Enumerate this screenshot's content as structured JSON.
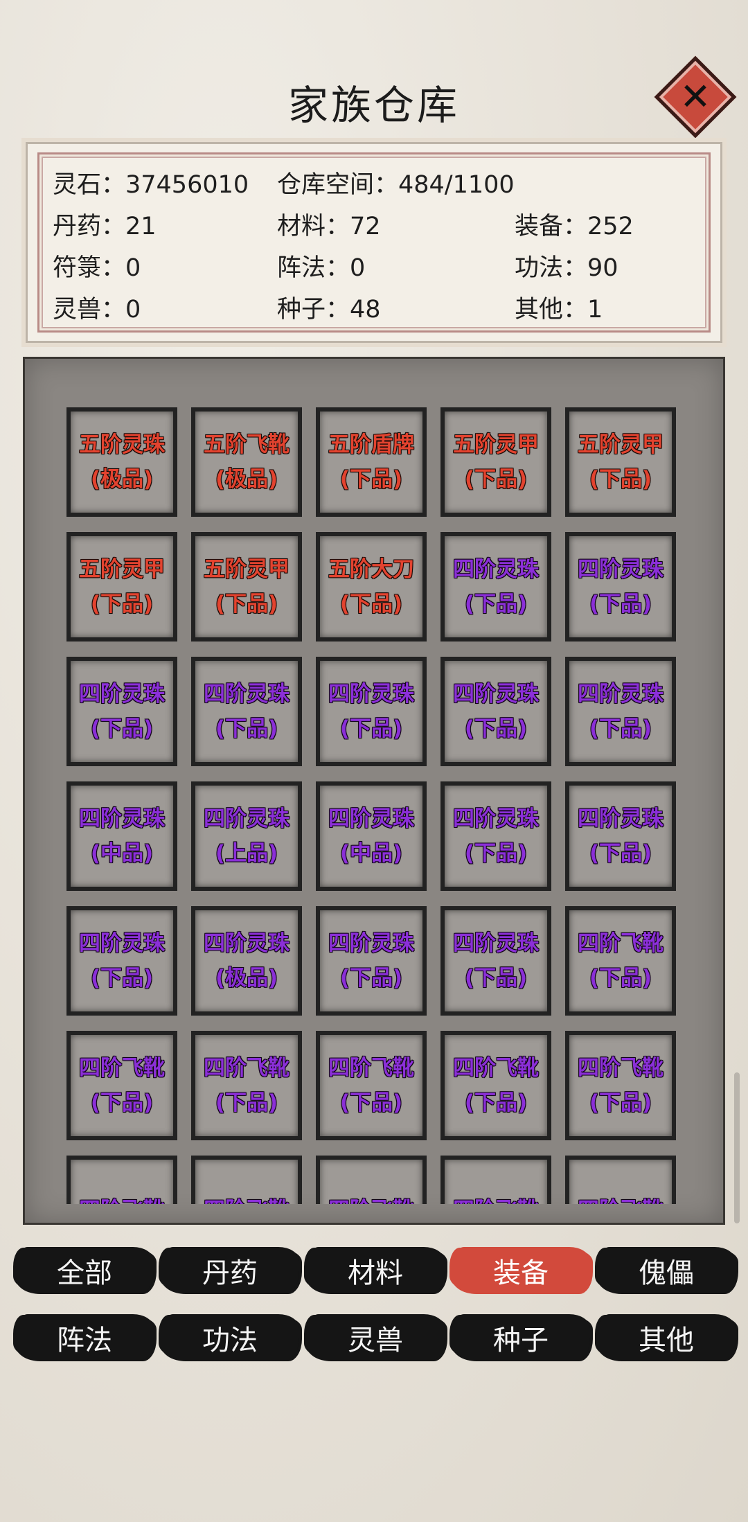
{
  "title": "家族仓库",
  "close_icon": "close-x-icon",
  "info": {
    "lingshi": "灵石：37456010",
    "space": "仓库空间：484/1100",
    "danyao": "丹药：21",
    "cailiao": "材料：72",
    "zhuangbei": "装备：252",
    "fulu": "符箓：0",
    "zhenfa": "阵法：0",
    "gongfa": "功法：90",
    "lingshou": "灵兽：0",
    "zhongzi": "种子：48",
    "qita": "其他：1"
  },
  "items": [
    {
      "name": "五阶灵珠",
      "grade": "(极品)",
      "color": "red"
    },
    {
      "name": "五阶飞靴",
      "grade": "(极品)",
      "color": "red"
    },
    {
      "name": "五阶盾牌",
      "grade": "(下品)",
      "color": "red"
    },
    {
      "name": "五阶灵甲",
      "grade": "(下品)",
      "color": "red"
    },
    {
      "name": "五阶灵甲",
      "grade": "(下品)",
      "color": "red"
    },
    {
      "name": "五阶灵甲",
      "grade": "(下品)",
      "color": "red"
    },
    {
      "name": "五阶灵甲",
      "grade": "(下品)",
      "color": "red"
    },
    {
      "name": "五阶大刀",
      "grade": "(下品)",
      "color": "red"
    },
    {
      "name": "四阶灵珠",
      "grade": "(下品)",
      "color": "purple"
    },
    {
      "name": "四阶灵珠",
      "grade": "(下品)",
      "color": "purple"
    },
    {
      "name": "四阶灵珠",
      "grade": "(下品)",
      "color": "purple"
    },
    {
      "name": "四阶灵珠",
      "grade": "(下品)",
      "color": "purple"
    },
    {
      "name": "四阶灵珠",
      "grade": "(下品)",
      "color": "purple"
    },
    {
      "name": "四阶灵珠",
      "grade": "(下品)",
      "color": "purple"
    },
    {
      "name": "四阶灵珠",
      "grade": "(下品)",
      "color": "purple"
    },
    {
      "name": "四阶灵珠",
      "grade": "(中品)",
      "color": "purple"
    },
    {
      "name": "四阶灵珠",
      "grade": "(上品)",
      "color": "purple"
    },
    {
      "name": "四阶灵珠",
      "grade": "(中品)",
      "color": "purple"
    },
    {
      "name": "四阶灵珠",
      "grade": "(下品)",
      "color": "purple"
    },
    {
      "name": "四阶灵珠",
      "grade": "(下品)",
      "color": "purple"
    },
    {
      "name": "四阶灵珠",
      "grade": "(下品)",
      "color": "purple"
    },
    {
      "name": "四阶灵珠",
      "grade": "(极品)",
      "color": "purple"
    },
    {
      "name": "四阶灵珠",
      "grade": "(下品)",
      "color": "purple"
    },
    {
      "name": "四阶灵珠",
      "grade": "(下品)",
      "color": "purple"
    },
    {
      "name": "四阶飞靴",
      "grade": "(下品)",
      "color": "purple"
    },
    {
      "name": "四阶飞靴",
      "grade": "(下品)",
      "color": "purple"
    },
    {
      "name": "四阶飞靴",
      "grade": "(下品)",
      "color": "purple"
    },
    {
      "name": "四阶飞靴",
      "grade": "(下品)",
      "color": "purple"
    },
    {
      "name": "四阶飞靴",
      "grade": "(下品)",
      "color": "purple"
    },
    {
      "name": "四阶飞靴",
      "grade": "(下品)",
      "color": "purple"
    },
    {
      "name": "四阶飞靴",
      "grade": "",
      "color": "purple"
    },
    {
      "name": "四阶飞靴",
      "grade": "",
      "color": "purple"
    },
    {
      "name": "四阶飞靴",
      "grade": "",
      "color": "purple"
    },
    {
      "name": "四阶飞靴",
      "grade": "",
      "color": "purple"
    },
    {
      "name": "四阶飞靴",
      "grade": "",
      "color": "purple"
    }
  ],
  "tabs": [
    {
      "label": "全部",
      "active": false
    },
    {
      "label": "丹药",
      "active": false
    },
    {
      "label": "材料",
      "active": false
    },
    {
      "label": "装备",
      "active": true
    },
    {
      "label": "傀儡",
      "active": false
    },
    {
      "label": "阵法",
      "active": false
    },
    {
      "label": "功法",
      "active": false
    },
    {
      "label": "灵兽",
      "active": false
    },
    {
      "label": "种子",
      "active": false
    },
    {
      "label": "其他",
      "active": false
    }
  ],
  "colors": {
    "accent_red": "#d24a3c",
    "item_red": "#e3432f",
    "item_purple": "#8b2fd8"
  }
}
